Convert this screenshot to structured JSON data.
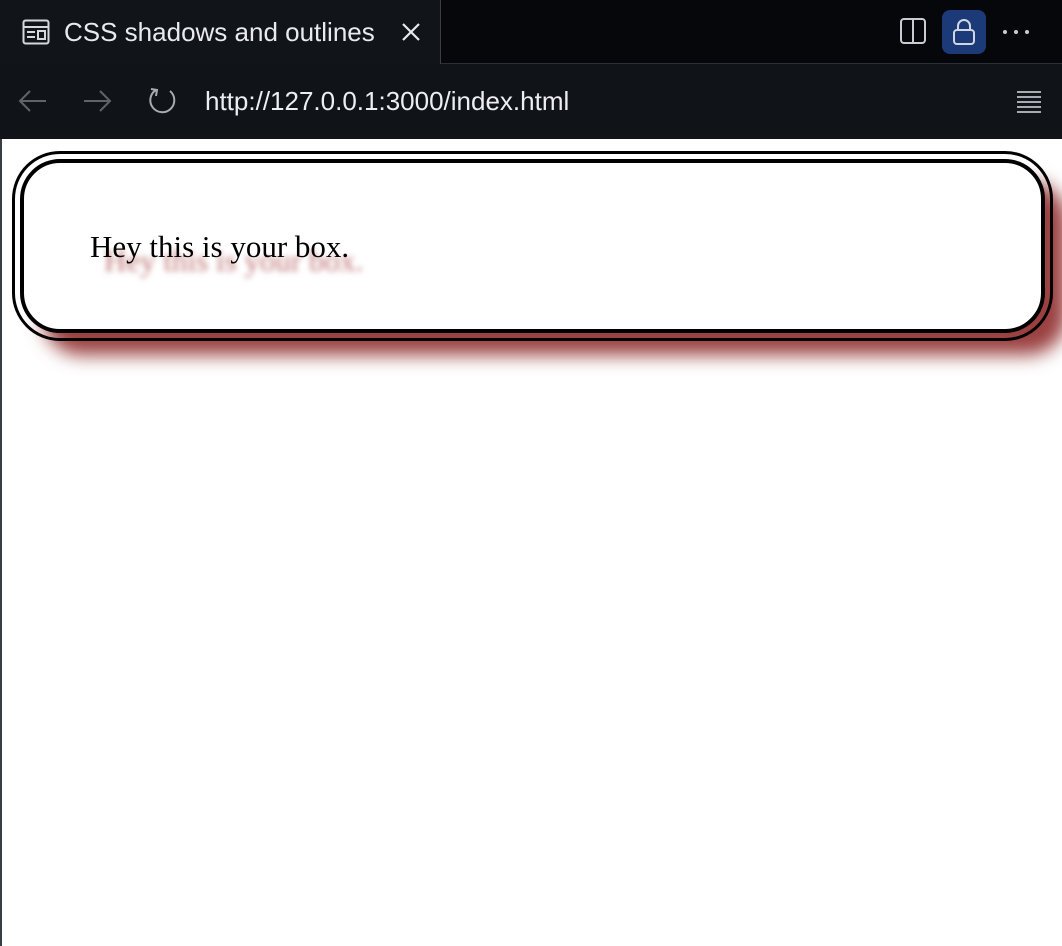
{
  "tab": {
    "title": "CSS shadows and outlines",
    "icon": "page-layout-icon"
  },
  "toolbar": {
    "split_icon": "split-view-icon",
    "lock_icon": "lock-icon",
    "lock_active_color": "#1c3a78",
    "more_icon": "more-horizontal-icon"
  },
  "navigation": {
    "back_icon": "arrow-left-icon",
    "forward_icon": "arrow-right-icon",
    "reload_icon": "reload-icon",
    "url": "http://127.0.0.1:3000/index.html",
    "reader_icon": "reader-mode-icon"
  },
  "page": {
    "box_text": "Hey this is your box.",
    "shadow_color": "#780000"
  }
}
